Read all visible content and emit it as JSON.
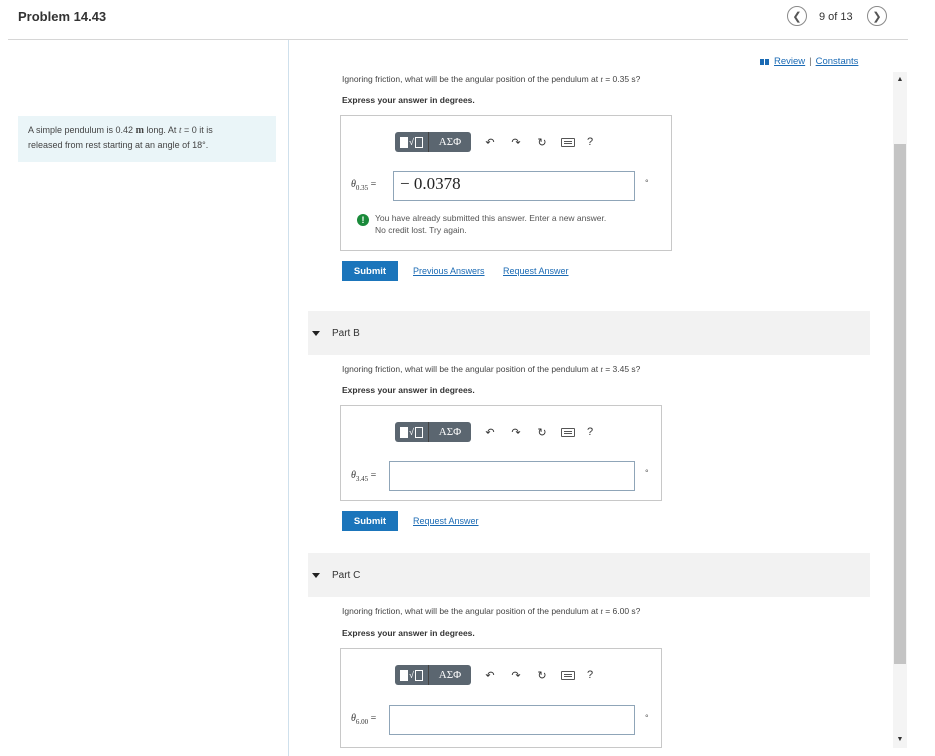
{
  "header": {
    "title": "Problem 14.43",
    "page_counter": "9 of 13",
    "prev_icon": "chevron-left",
    "next_icon": "chevron-right"
  },
  "links": {
    "review": "Review",
    "separator": "|",
    "constants": "Constants"
  },
  "problem": {
    "line1_a": "A simple pendulum is 0.42 ",
    "line1_unit": "m",
    "line1_b": " long. At ",
    "line1_t": "t",
    "line1_c": " = 0 it is",
    "line2": "released from rest starting at an angle of 18°."
  },
  "partA": {
    "question_a": "Ignoring friction, what will be the angular position of the pendulum at ",
    "question_t": "t",
    "question_b": " = 0.35 s?",
    "instruction": "Express your answer in degrees.",
    "label_sym": "θ",
    "label_sub": "0.35",
    "label_eq": " =",
    "value": "− 0.0378",
    "unit": "°",
    "warning_line1": "You have already submitted this answer. Enter a new answer.",
    "warning_line2": "No credit lost. Try again.",
    "submit": "Submit",
    "previous_answers": "Previous Answers",
    "request_answer": "Request Answer"
  },
  "partB": {
    "header": "Part B",
    "question_a": "Ignoring friction, what will be the angular position of the pendulum at ",
    "question_t": "t",
    "question_b": " = 3.45 s?",
    "instruction": "Express your answer in degrees.",
    "label_sym": "θ",
    "label_sub": "3.45",
    "label_eq": " =",
    "value": "",
    "unit": "°",
    "submit": "Submit",
    "request_answer": "Request Answer"
  },
  "partC": {
    "header": "Part C",
    "question_a": "Ignoring friction, what will be the angular position of the pendulum at ",
    "question_t": "t",
    "question_b": " = 6.00 s?",
    "instruction": "Express your answer in degrees.",
    "label_sym": "θ",
    "label_sub": "6.00",
    "label_eq": " =",
    "value": "",
    "unit": "°"
  },
  "toolbar": {
    "greek": "ΑΣΦ",
    "help": "?"
  },
  "colors": {
    "submit": "#1b75bb",
    "link": "#1a6ab4",
    "problem_bg": "#eaf5f8",
    "toolbar_btn": "#5b6670"
  }
}
